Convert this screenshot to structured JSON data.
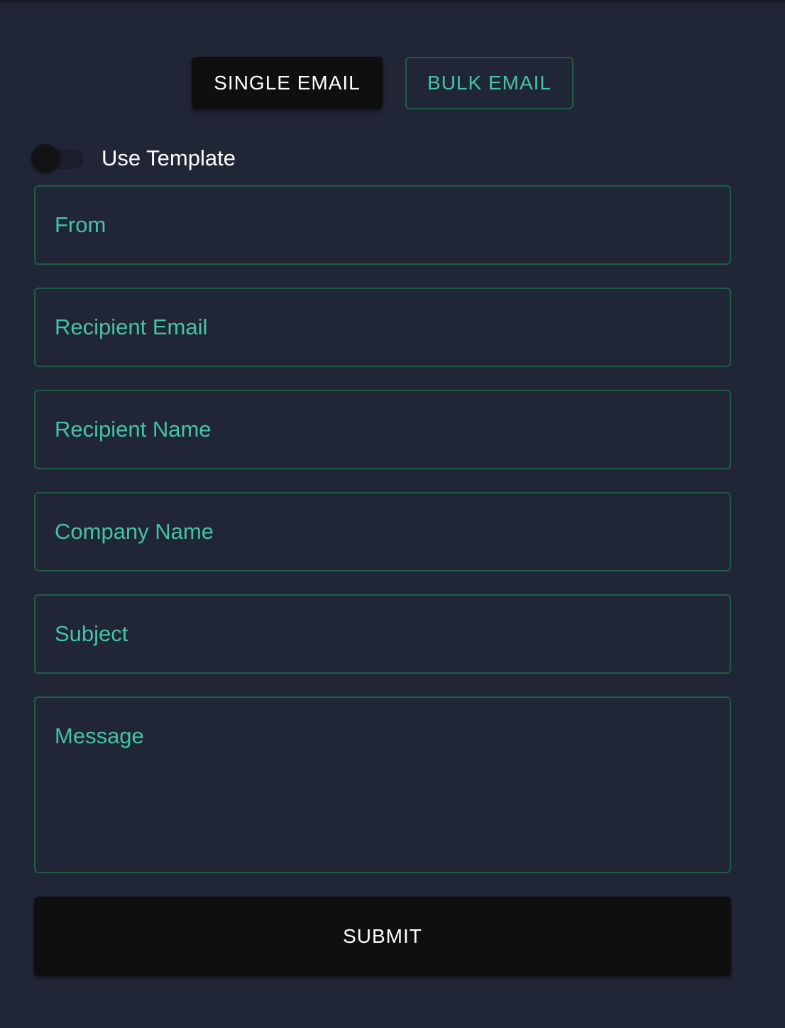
{
  "mode_tabs": {
    "single_label": "SINGLE EMAIL",
    "bulk_label": "BULK EMAIL",
    "active": "single"
  },
  "template_toggle": {
    "label": "Use Template",
    "checked": false
  },
  "fields": {
    "from": {
      "placeholder": "From",
      "value": ""
    },
    "recipient_email": {
      "placeholder": "Recipient Email",
      "value": ""
    },
    "recipient_name": {
      "placeholder": "Recipient Name",
      "value": ""
    },
    "company_name": {
      "placeholder": "Company Name",
      "value": ""
    },
    "subject": {
      "placeholder": "Subject",
      "value": ""
    },
    "message": {
      "placeholder": "Message",
      "value": ""
    }
  },
  "submit": {
    "label": "SUBMIT"
  },
  "colors": {
    "background": "#212637",
    "accent": "#45c3a3",
    "border": "#1f5c45",
    "button_dark": "#0f0f0f",
    "text": "#ffffff"
  }
}
